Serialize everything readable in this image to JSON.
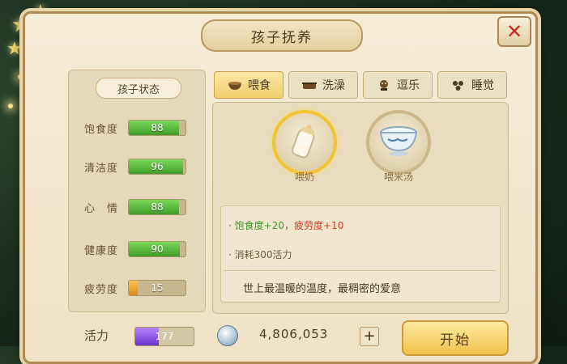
{
  "window": {
    "title": "孩子抚养",
    "close_icon": "close-icon"
  },
  "status_panel": {
    "heading": "孩子状态",
    "stats": [
      {
        "label": "饱食度",
        "value": "88",
        "level_pct": 88,
        "color": "#4caf2c"
      },
      {
        "label": "清洁度",
        "value": "96",
        "level_pct": 96,
        "color": "#4caf2c"
      },
      {
        "label": "心　情",
        "value": "88",
        "level_pct": 88,
        "color": "#4caf2c"
      },
      {
        "label": "健康度",
        "value": "90",
        "level_pct": 90,
        "color": "#4caf2c"
      },
      {
        "label": "疲劳度",
        "value": "15",
        "level_pct": 15,
        "color": "#f0a020"
      }
    ]
  },
  "tabs": [
    {
      "label": "喂食",
      "icon": "bowl-icon",
      "active": true
    },
    {
      "label": "洗澡",
      "icon": "bathtub-icon",
      "active": false
    },
    {
      "label": "逗乐",
      "icon": "toy-icon",
      "active": false
    },
    {
      "label": "睡觉",
      "icon": "sleep-icon",
      "active": false
    }
  ],
  "items": [
    {
      "label": "喂奶",
      "icon": "milk-bottle-icon",
      "selected": true
    },
    {
      "label": "喂米汤",
      "icon": "soup-bowl-icon",
      "selected": false
    }
  ],
  "detail": {
    "effect_gain": "饱食度+20",
    "separator": "，",
    "effect_cost": "疲劳度+10",
    "bullet": "·",
    "consume": "消耗300活力",
    "description": "世上最温暖的温度，最稠密的爱意"
  },
  "footer": {
    "vitality_label": "活力",
    "vitality_value": "177",
    "vitality_pct": 40,
    "currency_icon": "silver-coin-icon",
    "currency_value": "4,806,053",
    "plus_label": "+",
    "start_label": "开始"
  },
  "colors": {
    "accent_gold": "#f2c436",
    "gain_green": "#3d9a2b",
    "cost_red": "#d13a22"
  }
}
